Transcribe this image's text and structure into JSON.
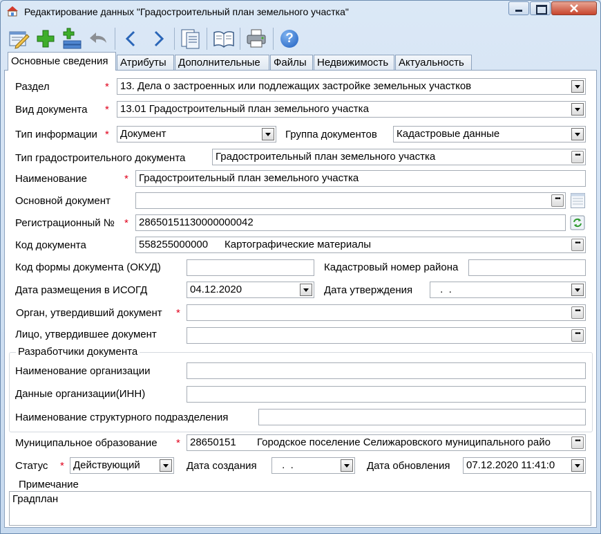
{
  "window": {
    "title": "Редактирование данных \"Градостроительный план земельного участка\""
  },
  "tabs": [
    {
      "label": "Основные сведения"
    },
    {
      "label": "Атрибуты"
    },
    {
      "label": "Дополнительные"
    },
    {
      "label": "Файлы"
    },
    {
      "label": "Недвижимость"
    },
    {
      "label": "Актуальность"
    }
  ],
  "toolbar": {
    "icons": [
      "edit-icon",
      "add-icon",
      "add-record-icon",
      "undo-icon",
      "back-arrow-icon",
      "forward-arrow-icon",
      "documents-icon",
      "book-icon",
      "printer-icon",
      "help-icon"
    ],
    "help_glyph": "?"
  },
  "required_mark": "*",
  "form": {
    "razdel": {
      "label": "Раздел",
      "value": "13. Дела о застроенных или подлежащих застройке земельных участков"
    },
    "vid": {
      "label": "Вид документа",
      "value": "13.01  Градостроительный план земельного участка"
    },
    "tip_info": {
      "label": "Тип информации",
      "value": "Документ"
    },
    "gruppa": {
      "label": "Группа документов",
      "value": "Кадастровые данные"
    },
    "tip_grad": {
      "label": "Тип градостроительного документа",
      "value": "Градостроительный план земельного участка"
    },
    "naim": {
      "label": "Наименование",
      "value": "Градостроительный план земельного участка"
    },
    "osnovnoy": {
      "label": "Основной документ",
      "value": ""
    },
    "reg": {
      "label": "Регистрационный №",
      "value": "28650151130000000042"
    },
    "kod": {
      "label": "Код документа",
      "code": "558255000000",
      "name": "Картографические материалы"
    },
    "okud": {
      "label": "Код формы документа (ОКУД)",
      "value": ""
    },
    "kadastr": {
      "label": "Кадастровый номер района",
      "value": ""
    },
    "data_razm": {
      "label": "Дата размещения в ИСОГД",
      "value": "04.12.2020"
    },
    "data_utv": {
      "label": "Дата утверждения",
      "value": " .  ."
    },
    "organ": {
      "label": "Орган, утвердивший документ",
      "value": ""
    },
    "lico": {
      "label": "Лицо, утвердившее документ",
      "value": ""
    }
  },
  "developers": {
    "title": "Разработчики документа",
    "org_name": {
      "label": "Наименование организации",
      "value": ""
    },
    "org_inn": {
      "label": "Данные организации(ИНН)",
      "value": ""
    },
    "dept": {
      "label": "Наименование структурного подразделения",
      "value": ""
    }
  },
  "municipal": {
    "label": "Муниципальное образование",
    "code": "28650151",
    "name": "Городское поселение Селижаровского муниципального райо"
  },
  "status": {
    "label": "Статус",
    "value": "Действующий"
  },
  "created": {
    "label": "Дата создания",
    "value": " .  ."
  },
  "updated": {
    "label": "Дата обновления",
    "value": "07.12.2020 11:41:0"
  },
  "note": {
    "title": "Примечание",
    "value": "Градплан"
  }
}
